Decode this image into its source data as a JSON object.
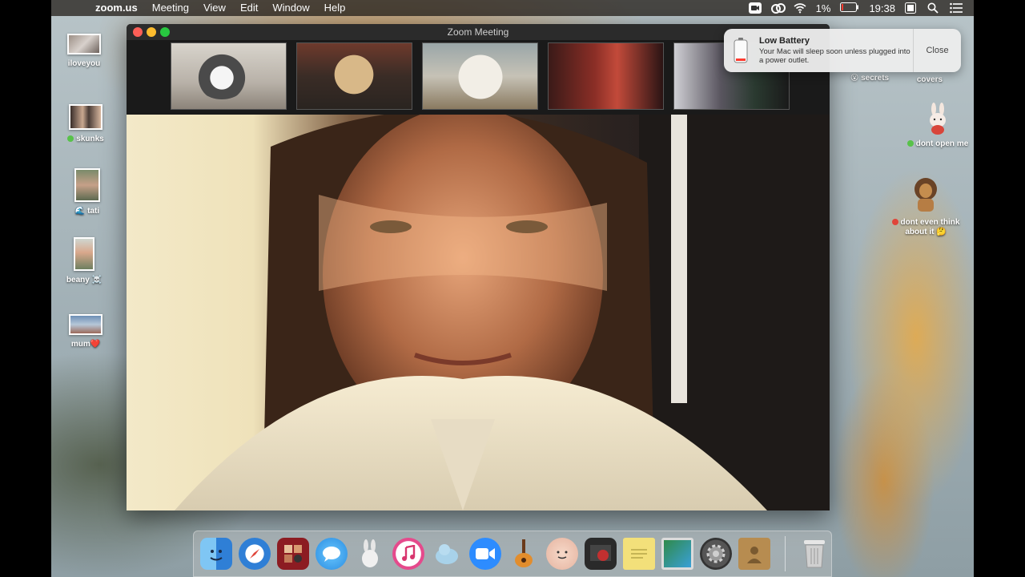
{
  "menubar": {
    "app_name": "zoom.us",
    "menus": [
      "Meeting",
      "View",
      "Edit",
      "Window",
      "Help"
    ],
    "battery_percent": "1%",
    "clock": "19:38"
  },
  "window": {
    "title": "Zoom Meeting"
  },
  "notification": {
    "title": "Low Battery",
    "text": "Your Mac will sleep soon unless plugged into a power outlet.",
    "close_label": "Close"
  },
  "desktop_left": [
    {
      "label": "iloveyou"
    },
    {
      "label": "skunks",
      "dot_color": "#58c24a"
    },
    {
      "label": "tati",
      "emoji": "🌊"
    },
    {
      "label": "beany",
      "emoji": "☠️"
    },
    {
      "label": "mum",
      "emoji": "❤️"
    }
  ],
  "desktop_right": [
    {
      "label": "secrets",
      "emoji": "😮"
    },
    {
      "label": "covers"
    },
    {
      "label": "dont open me",
      "dot_color": "#58c24a"
    },
    {
      "label": "dont even think about it",
      "emoji": "🤔",
      "dot_color": "#e0453a"
    }
  ],
  "dock": {
    "apps": [
      {
        "name": "finder-icon",
        "color": "#3b8de0"
      },
      {
        "name": "safari-icon",
        "color": "#2f7fd6"
      },
      {
        "name": "photo-booth-icon",
        "color": "#8c1c22"
      },
      {
        "name": "messages-icon",
        "color": "#2fa3f0"
      },
      {
        "name": "rabbit-app-icon",
        "color": "#b7b7b7"
      },
      {
        "name": "itunes-icon",
        "color": "#e54a8c"
      },
      {
        "name": "seal-app-icon",
        "color": "#7ab3d6"
      },
      {
        "name": "zoom-icon",
        "color": "#2d8cff"
      },
      {
        "name": "garageband-icon",
        "color": "#e28d2d"
      },
      {
        "name": "avatar-app-icon",
        "color": "#f1c6b0"
      },
      {
        "name": "photo-app-icon",
        "color": "#c23030"
      },
      {
        "name": "stickies-icon",
        "color": "#f3e07a"
      },
      {
        "name": "preview-icon",
        "color": "#3aa0d8"
      },
      {
        "name": "system-preferences-icon",
        "color": "#6e6e6e"
      },
      {
        "name": "contacts-icon",
        "color": "#b78c50"
      }
    ],
    "trash": {
      "name": "trash-icon",
      "color": "#cfcfcf"
    }
  }
}
